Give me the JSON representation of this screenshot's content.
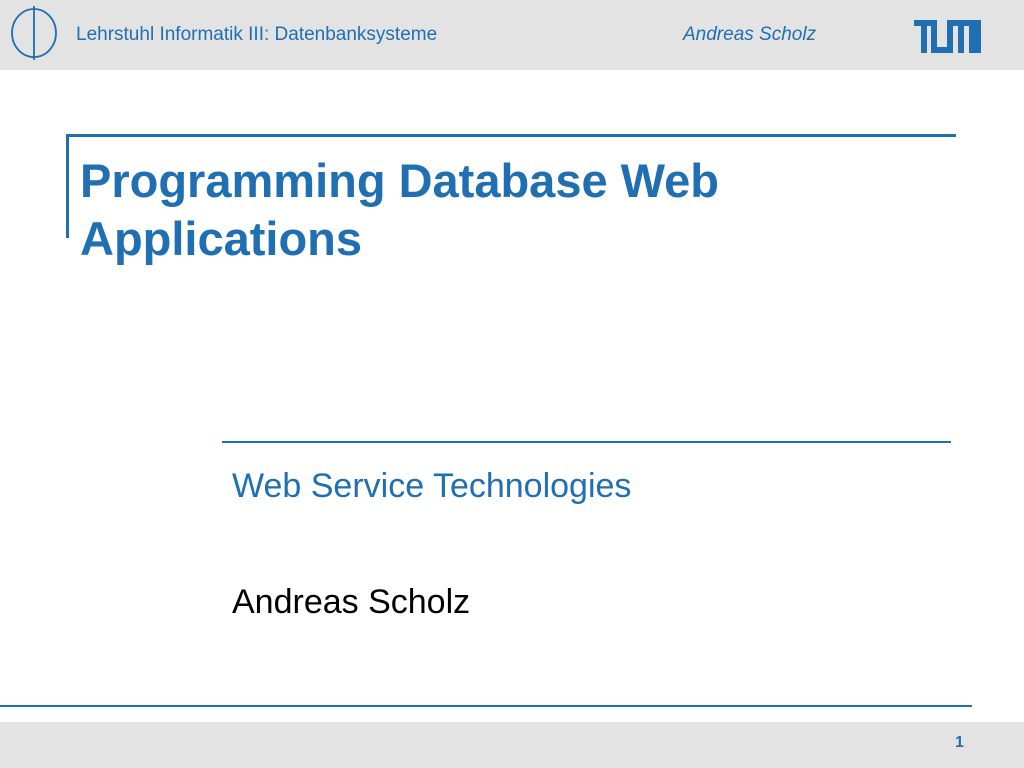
{
  "header": {
    "chair": "Lehrstuhl Informatik III: Datenbanksysteme",
    "author": "Andreas Scholz",
    "seal_icon": "university-seal-icon",
    "logo_icon": "tum-logo-icon"
  },
  "slide": {
    "title": "Programming Database Web Applications",
    "subtitle": "Web Service Technologies",
    "author": "Andreas Scholz"
  },
  "footer": {
    "page_number": "1"
  },
  "colors": {
    "accent": "#1f6fb2",
    "bar_background": "#e3e3e3",
    "text": "#000000"
  }
}
